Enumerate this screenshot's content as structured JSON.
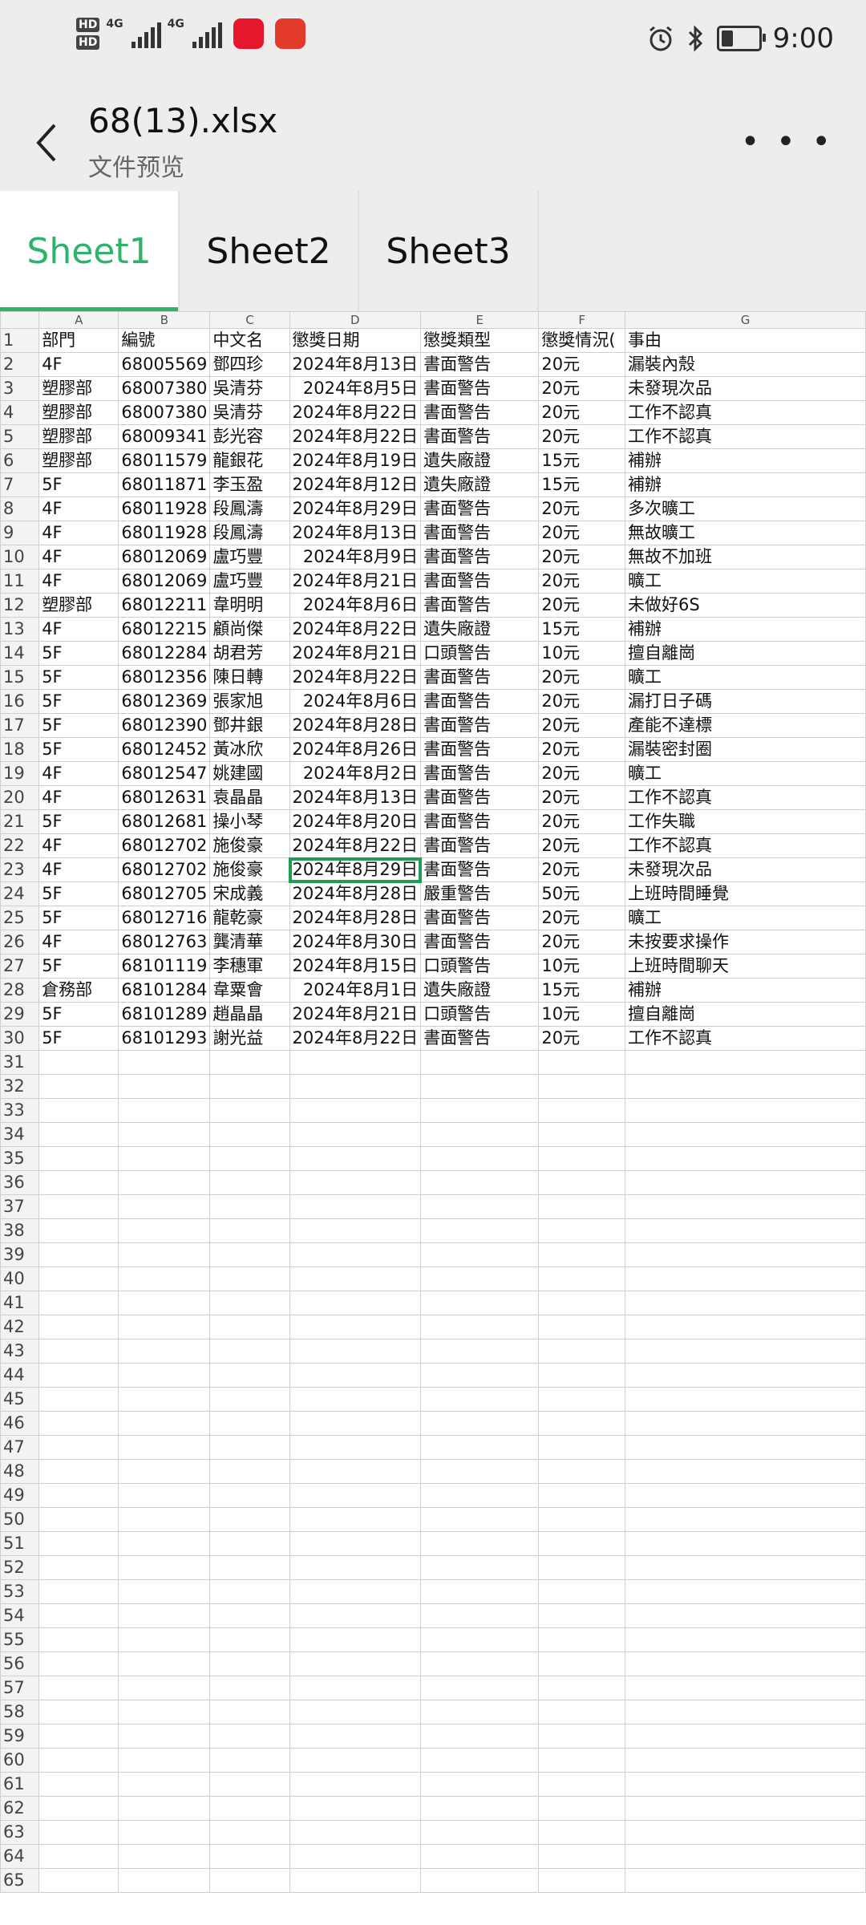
{
  "status": {
    "time": "9:00",
    "hd1": "HD",
    "hd2": "HD",
    "net1": "4G",
    "net2": "4G"
  },
  "header": {
    "title": "68(13).xlsx",
    "subtitle": "文件预览",
    "back_icon": "chevron-left-icon",
    "more_label": "…",
    "bg": "#ededed"
  },
  "tabs": [
    {
      "label": "Sheet1",
      "active": true
    },
    {
      "label": "Sheet2"
    },
    {
      "label": "Sheet3"
    }
  ],
  "accent": "#2db36a",
  "columns": [
    "A",
    "B",
    "C",
    "D",
    "E",
    "F",
    "G"
  ],
  "headers": [
    "部門",
    "編號",
    "中文名",
    "懲獎日期",
    "懲獎類型",
    "懲獎情況(",
    "事由"
  ],
  "rows": [
    [
      "4F",
      "68005569",
      "鄧四珍",
      "2024年8月13日",
      "書面警告",
      "20元",
      "漏裝內殼"
    ],
    [
      "塑膠部",
      "68007380",
      "吳清芬",
      "2024年8月5日",
      "書面警告",
      "20元",
      "未發現次品"
    ],
    [
      "塑膠部",
      "68007380",
      "吳清芬",
      "2024年8月22日",
      "書面警告",
      "20元",
      "工作不認真"
    ],
    [
      "塑膠部",
      "68009341",
      "彭光容",
      "2024年8月22日",
      "書面警告",
      "20元",
      "工作不認真"
    ],
    [
      "塑膠部",
      "68011579",
      "龍銀花",
      "2024年8月19日",
      "遺失廠證",
      "15元",
      "補辦"
    ],
    [
      "5F",
      "68011871",
      "李玉盈",
      "2024年8月12日",
      "遺失廠證",
      "15元",
      "補辦"
    ],
    [
      "4F",
      "68011928",
      "段鳳濤",
      "2024年8月29日",
      "書面警告",
      "20元",
      "多次曠工"
    ],
    [
      "4F",
      "68011928",
      "段鳳濤",
      "2024年8月13日",
      "書面警告",
      "20元",
      "無故曠工"
    ],
    [
      "4F",
      "68012069",
      "盧巧豐",
      "2024年8月9日",
      "書面警告",
      "20元",
      "無故不加班"
    ],
    [
      "4F",
      "68012069",
      "盧巧豐",
      "2024年8月21日",
      "書面警告",
      "20元",
      "曠工"
    ],
    [
      "塑膠部",
      "68012211",
      "韋明明",
      "2024年8月6日",
      "書面警告",
      "20元",
      "未做好6S"
    ],
    [
      "4F",
      "68012215",
      "顧尚傑",
      "2024年8月22日",
      "遺失廠證",
      "15元",
      "補辦"
    ],
    [
      "5F",
      "68012284",
      "胡君芳",
      "2024年8月21日",
      "口頭警告",
      "10元",
      "擅自離崗"
    ],
    [
      "5F",
      "68012356",
      "陳日轉",
      "2024年8月22日",
      "書面警告",
      "20元",
      "曠工"
    ],
    [
      "5F",
      "68012369",
      "張家旭",
      "2024年8月6日",
      "書面警告",
      "20元",
      "漏打日子碼"
    ],
    [
      "5F",
      "68012390",
      "鄧井銀",
      "2024年8月28日",
      "書面警告",
      "20元",
      "產能不達標"
    ],
    [
      "5F",
      "68012452",
      "黃冰欣",
      "2024年8月26日",
      "書面警告",
      "20元",
      "漏裝密封圈"
    ],
    [
      "4F",
      "68012547",
      "姚建國",
      "2024年8月2日",
      "書面警告",
      "20元",
      "曠工"
    ],
    [
      "4F",
      "68012631",
      "袁晶晶",
      "2024年8月13日",
      "書面警告",
      "20元",
      "工作不認真"
    ],
    [
      "5F",
      "68012681",
      "操小琴",
      "2024年8月20日",
      "書面警告",
      "20元",
      "工作失職"
    ],
    [
      "4F",
      "68012702",
      "施俊豪",
      "2024年8月22日",
      "書面警告",
      "20元",
      "工作不認真"
    ],
    [
      "4F",
      "68012702",
      "施俊豪",
      "2024年8月29日",
      "書面警告",
      "20元",
      "未發現次品"
    ],
    [
      "5F",
      "68012705",
      "宋成義",
      "2024年8月28日",
      "嚴重警告",
      "50元",
      "上班時間睡覺"
    ],
    [
      "5F",
      "68012716",
      "龍乾豪",
      "2024年8月28日",
      "書面警告",
      "20元",
      "曠工"
    ],
    [
      "4F",
      "68012763",
      "龔清華",
      "2024年8月30日",
      "書面警告",
      "20元",
      "未按要求操作"
    ],
    [
      "5F",
      "68101119",
      "李穗軍",
      "2024年8月15日",
      "口頭警告",
      "10元",
      "上班時間聊天"
    ],
    [
      "倉務部",
      "68101284",
      "韋粟會",
      "2024年8月1日",
      "遺失廠證",
      "15元",
      "補辦"
    ],
    [
      "5F",
      "68101289",
      "趙晶晶",
      "2024年8月21日",
      "口頭警告",
      "10元",
      "擅自離崗"
    ],
    [
      "5F",
      "68101293",
      "謝光益",
      "2024年8月22日",
      "書面警告",
      "20元",
      "工作不認真"
    ]
  ],
  "selected": {
    "row": 23,
    "col": "D"
  },
  "total_rows": 65
}
